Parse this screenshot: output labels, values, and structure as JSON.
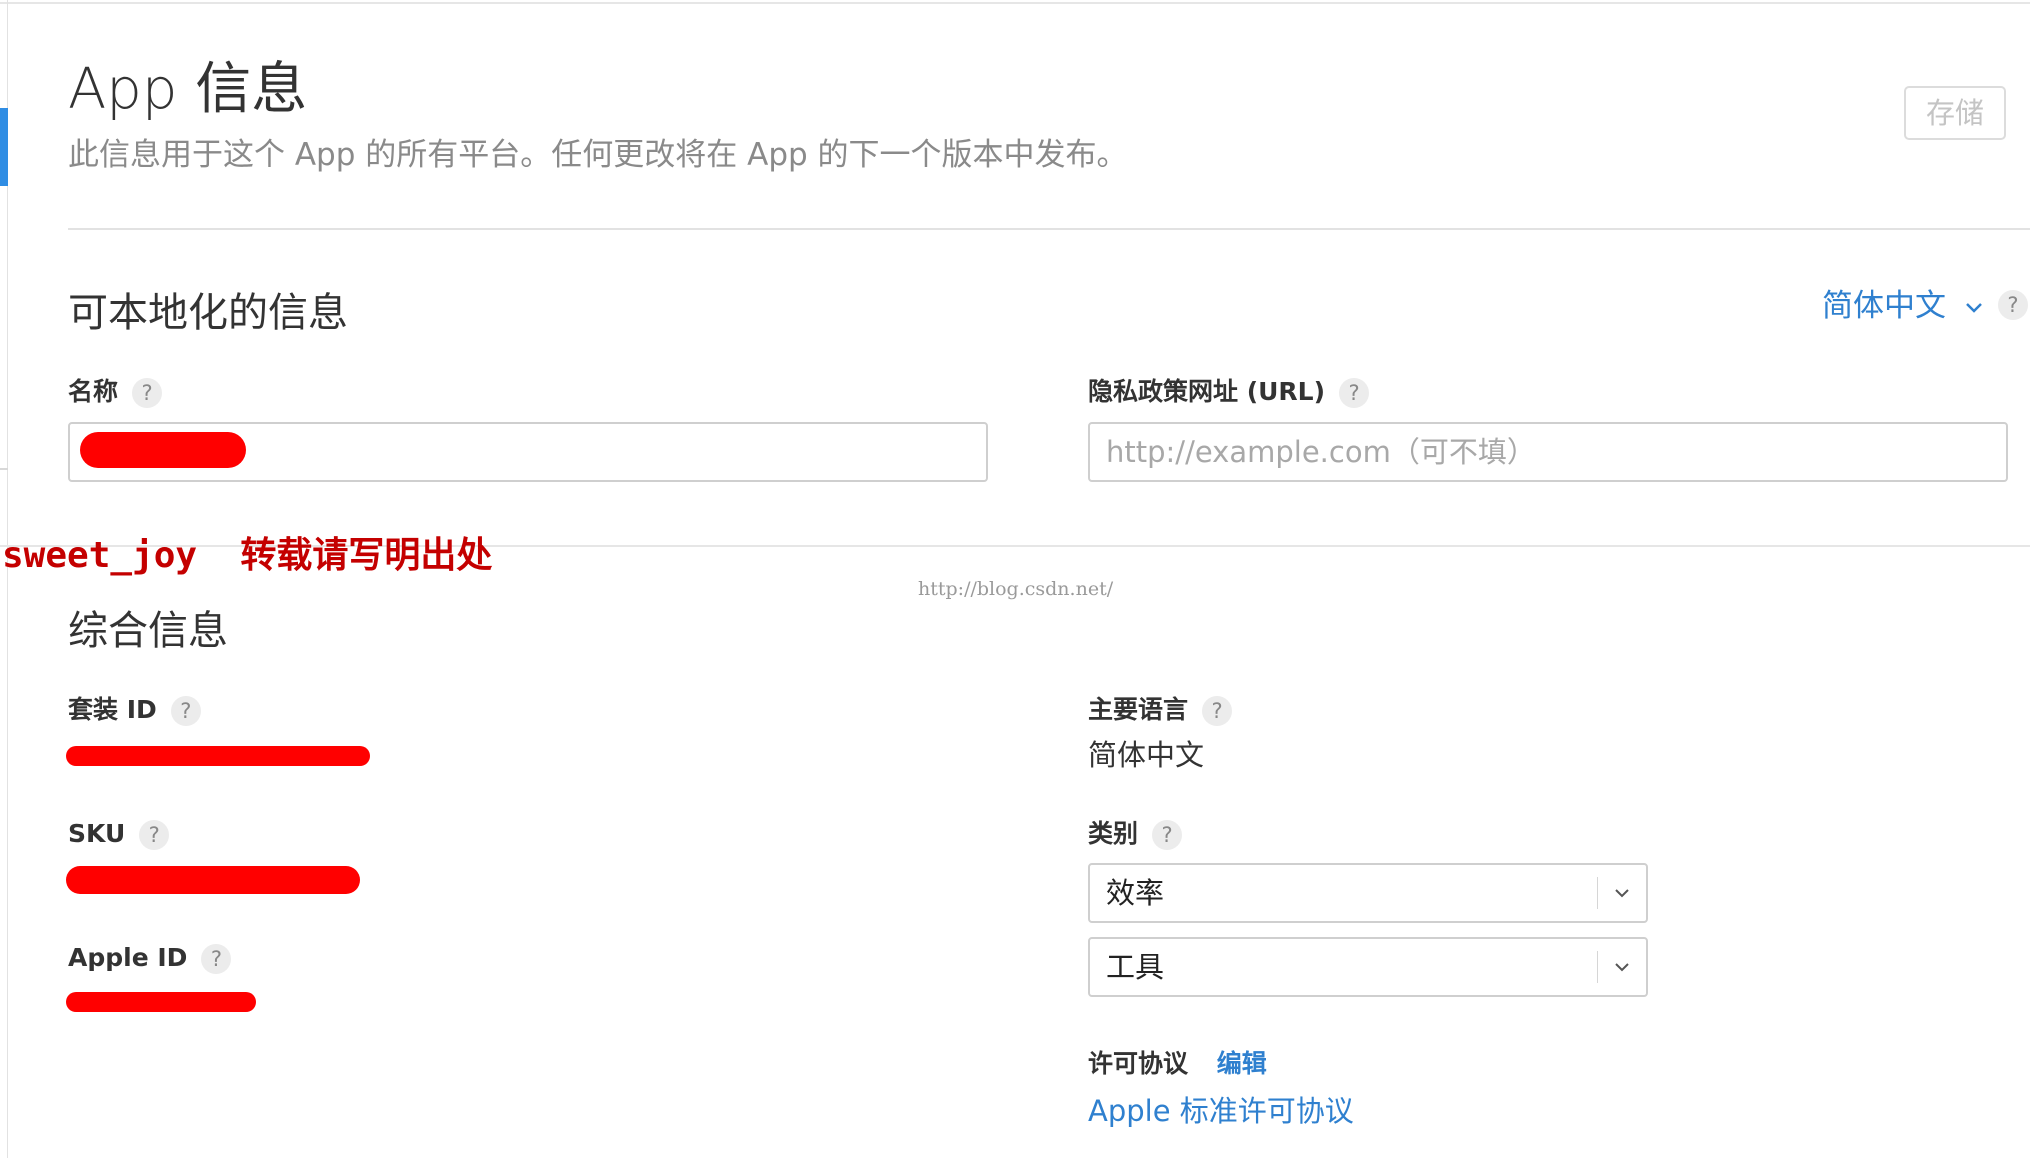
{
  "header": {
    "title": "App 信息",
    "subtitle": "此信息用于这个 App 的所有平台。任何更改将在 App 的下一个版本中发布。",
    "save_label": "存储"
  },
  "localizable": {
    "section_title": "可本地化的信息",
    "language_selector": "简体中文",
    "help_icon": "?",
    "name": {
      "label": "名称",
      "value": "",
      "redacted": true
    },
    "privacy_url": {
      "label": "隐私政策网址 (URL)",
      "placeholder": "http://example.com（可不填）",
      "value": ""
    }
  },
  "watermark": {
    "text": "sweet_joy  转载请写明出处",
    "url": "http://blog.csdn.net/"
  },
  "general": {
    "section_title": "综合信息",
    "bundle_id": {
      "label": "套装 ID",
      "value_redacted": true
    },
    "sku": {
      "label": "SKU",
      "value_redacted": true
    },
    "apple_id": {
      "label": "Apple ID",
      "value_redacted": true
    },
    "primary_language": {
      "label": "主要语言",
      "value": "简体中文"
    },
    "category": {
      "label": "类别",
      "primary": "效率",
      "secondary": "工具"
    },
    "license": {
      "label": "许可协议",
      "edit_label": "编辑",
      "link_text": "Apple 标准许可协议"
    }
  },
  "colors": {
    "accent": "#2f80cf",
    "redaction": "#ff0000",
    "watermark": "#c40000"
  },
  "icons": {
    "help": "question-mark-circle",
    "dropdown": "chevron-down"
  }
}
